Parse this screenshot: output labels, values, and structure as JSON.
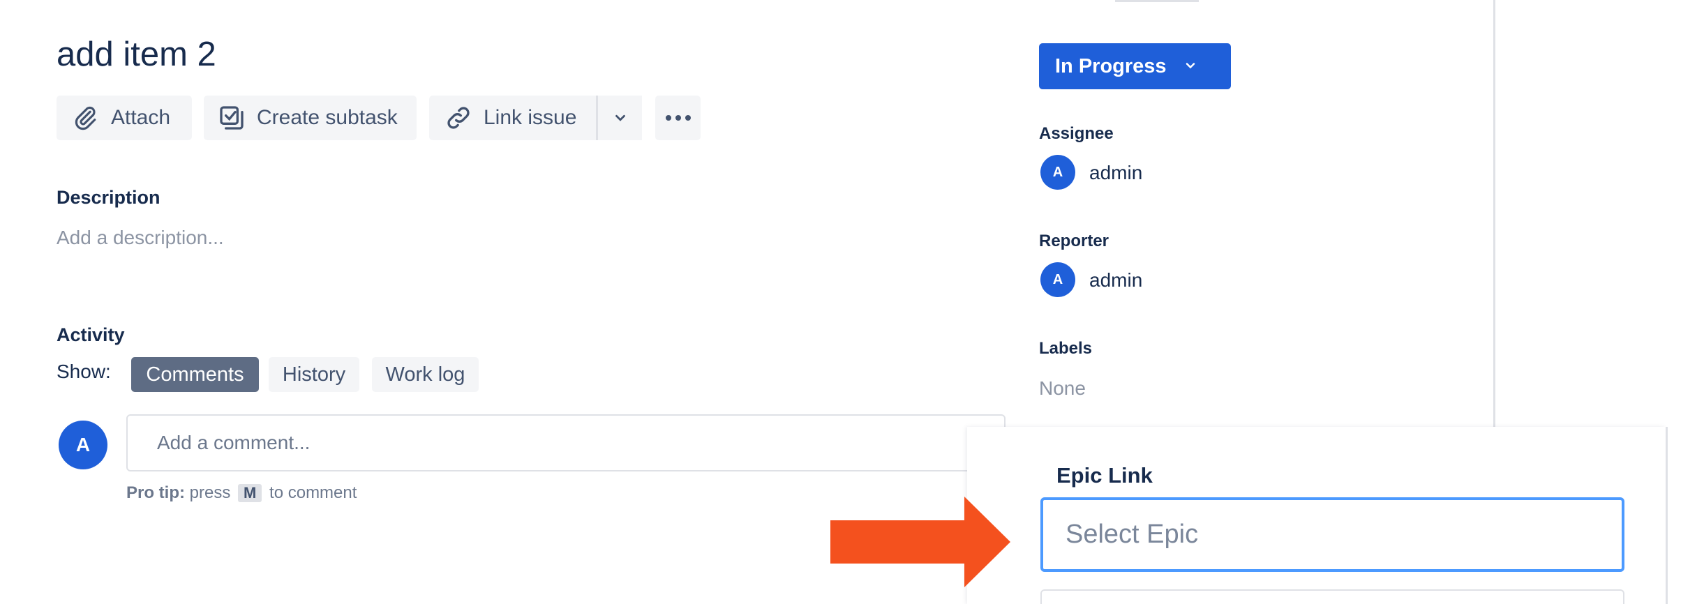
{
  "issue": {
    "title": "add item 2"
  },
  "toolbar": {
    "attach_label": "Attach",
    "create_subtask_label": "Create subtask",
    "link_issue_label": "Link issue"
  },
  "description": {
    "heading": "Description",
    "placeholder": "Add a description..."
  },
  "activity": {
    "heading": "Activity",
    "show_label": "Show:",
    "filters": [
      {
        "label": "Comments",
        "active": true
      },
      {
        "label": "History",
        "active": false
      },
      {
        "label": "Work log",
        "active": false
      }
    ],
    "avatar_initial": "A",
    "comment_placeholder": "Add a comment...",
    "pro_tip_prefix": "Pro tip:",
    "pro_tip_press": "press",
    "pro_tip_key": "M",
    "pro_tip_suffix": "to comment"
  },
  "sidebar": {
    "status_label": "In Progress",
    "assignee_heading": "Assignee",
    "assignee_initial": "A",
    "assignee_name": "admin",
    "reporter_heading": "Reporter",
    "reporter_initial": "A",
    "reporter_name": "admin",
    "labels_heading": "Labels",
    "labels_value": "None"
  },
  "epic_link": {
    "heading": "Epic Link",
    "placeholder": "Select Epic"
  },
  "colors": {
    "primary": "#1f5fd9",
    "focus_border": "#4c9aff",
    "annotation_arrow": "#f4511e",
    "active_chip": "#5e6c84"
  }
}
